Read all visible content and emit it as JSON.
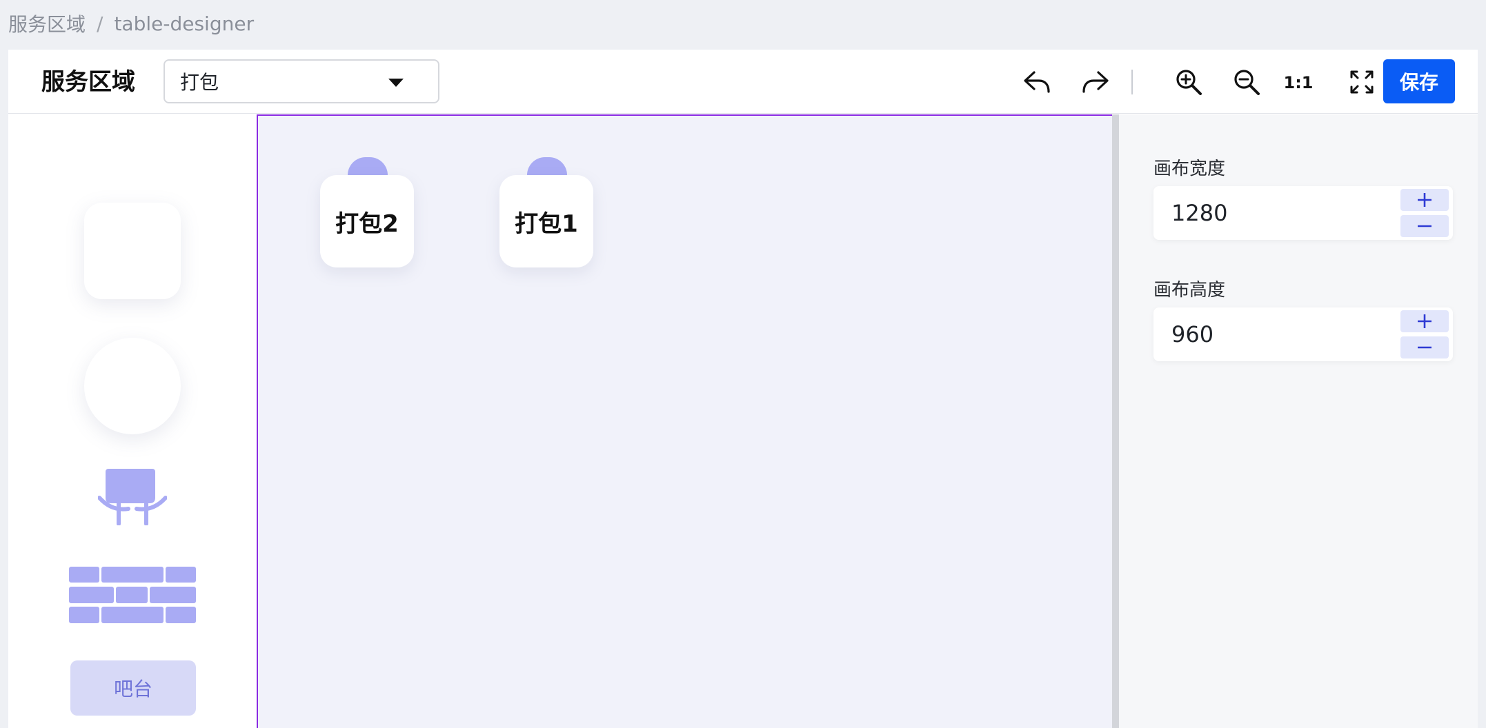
{
  "breadcrumb": {
    "root": "服务区域",
    "separator": "/",
    "current": "table-designer"
  },
  "toolbar": {
    "title": "服务区域",
    "area_select_value": "打包",
    "undo_icon": "undo-icon",
    "redo_icon": "redo-icon",
    "zoom_in_icon": "zoom-in-icon",
    "zoom_out_icon": "zoom-out-icon",
    "ratio_label": "1:1",
    "fit_icon": "fullscreen-icon",
    "save_label": "保存"
  },
  "palette": {
    "items": [
      "square-table",
      "round-table",
      "chair",
      "wall",
      "bar"
    ],
    "bar_label": "吧台"
  },
  "canvas": {
    "tables": [
      {
        "label": "打包2"
      },
      {
        "label": "打包1"
      }
    ]
  },
  "properties": {
    "width_label": "画布宽度",
    "width_value": "1280",
    "height_label": "画布高度",
    "height_value": "960"
  },
  "colors": {
    "accent": "#0a5cf5",
    "canvas_border": "#8a2be2",
    "element_fill": "#a9abf4",
    "bar_fill": "#d7d9f7"
  }
}
